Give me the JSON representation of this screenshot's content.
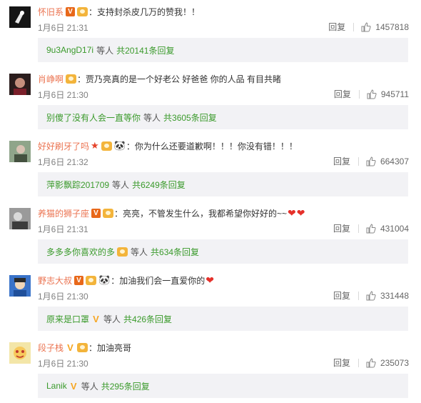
{
  "colors": {
    "username": "#eb7350",
    "link_green": "#3a9a2b",
    "reply_bg": "#f2f2f5",
    "heart": "#e5302a"
  },
  "comments": [
    {
      "username": "怀旧系",
      "badges": [
        "v-red",
        "fan-badge"
      ],
      "text": "：支持封杀皮几万的赞我！！",
      "time": "1月6日 21:31",
      "reply": "回复",
      "likes": "1457818",
      "replies": {
        "users": "9u3AngD17i",
        "suffix": "等人",
        "count": "共20141条回复"
      }
    },
    {
      "username": "肖峥啊",
      "badges": [
        "fan-badge"
      ],
      "text": "：贾乃亮真的是一个好老公 好爸爸 你的人品 有目共睹",
      "time": "1月6日 21:30",
      "reply": "回复",
      "likes": "945711",
      "replies": {
        "users": "别傻了没有人会一直等你",
        "suffix": "等人",
        "count": "共3605条回复"
      }
    },
    {
      "username": "好好刷牙了吗",
      "badges": [
        "star",
        "fan-badge",
        "panda"
      ],
      "text": "：你为什么还要道歉啊！！！你没有错！！！",
      "time": "1月6日 21:32",
      "reply": "回复",
      "likes": "664307",
      "replies": {
        "users": "萍影飘踪201709",
        "suffix": "等人",
        "count": "共6249条回复"
      }
    },
    {
      "username": "养猫的狮子座",
      "badges": [
        "v-red",
        "fan-badge"
      ],
      "text": "：亮亮，不管发生什么，我都希望你好好的~~",
      "hearts": 2,
      "time": "1月6日 21:31",
      "reply": "回复",
      "likes": "431004",
      "replies": {
        "users": "多多多你喜欢的多",
        "user_badge": "fan-badge",
        "suffix": "等人",
        "count": "共634条回复"
      }
    },
    {
      "username": "野志大叔",
      "badges": [
        "v-red",
        "fan-badge",
        "panda"
      ],
      "text": "：加油我们会一直爱你的",
      "hearts": 1,
      "time": "1月6日 21:30",
      "reply": "回复",
      "likes": "331448",
      "replies": {
        "users": "原来是口罩",
        "user_badge": "v-orange",
        "suffix": "等人",
        "count": "共426条回复"
      }
    },
    {
      "username": "段子栈",
      "badges": [
        "v-orange",
        "fan-badge"
      ],
      "text": "：加油亮哥",
      "time": "1月6日 21:30",
      "reply": "回复",
      "likes": "235073",
      "replies": {
        "users": "Lanik",
        "user_badge": "v-orange",
        "suffix": "等人",
        "count": "共295条回复"
      }
    }
  ]
}
